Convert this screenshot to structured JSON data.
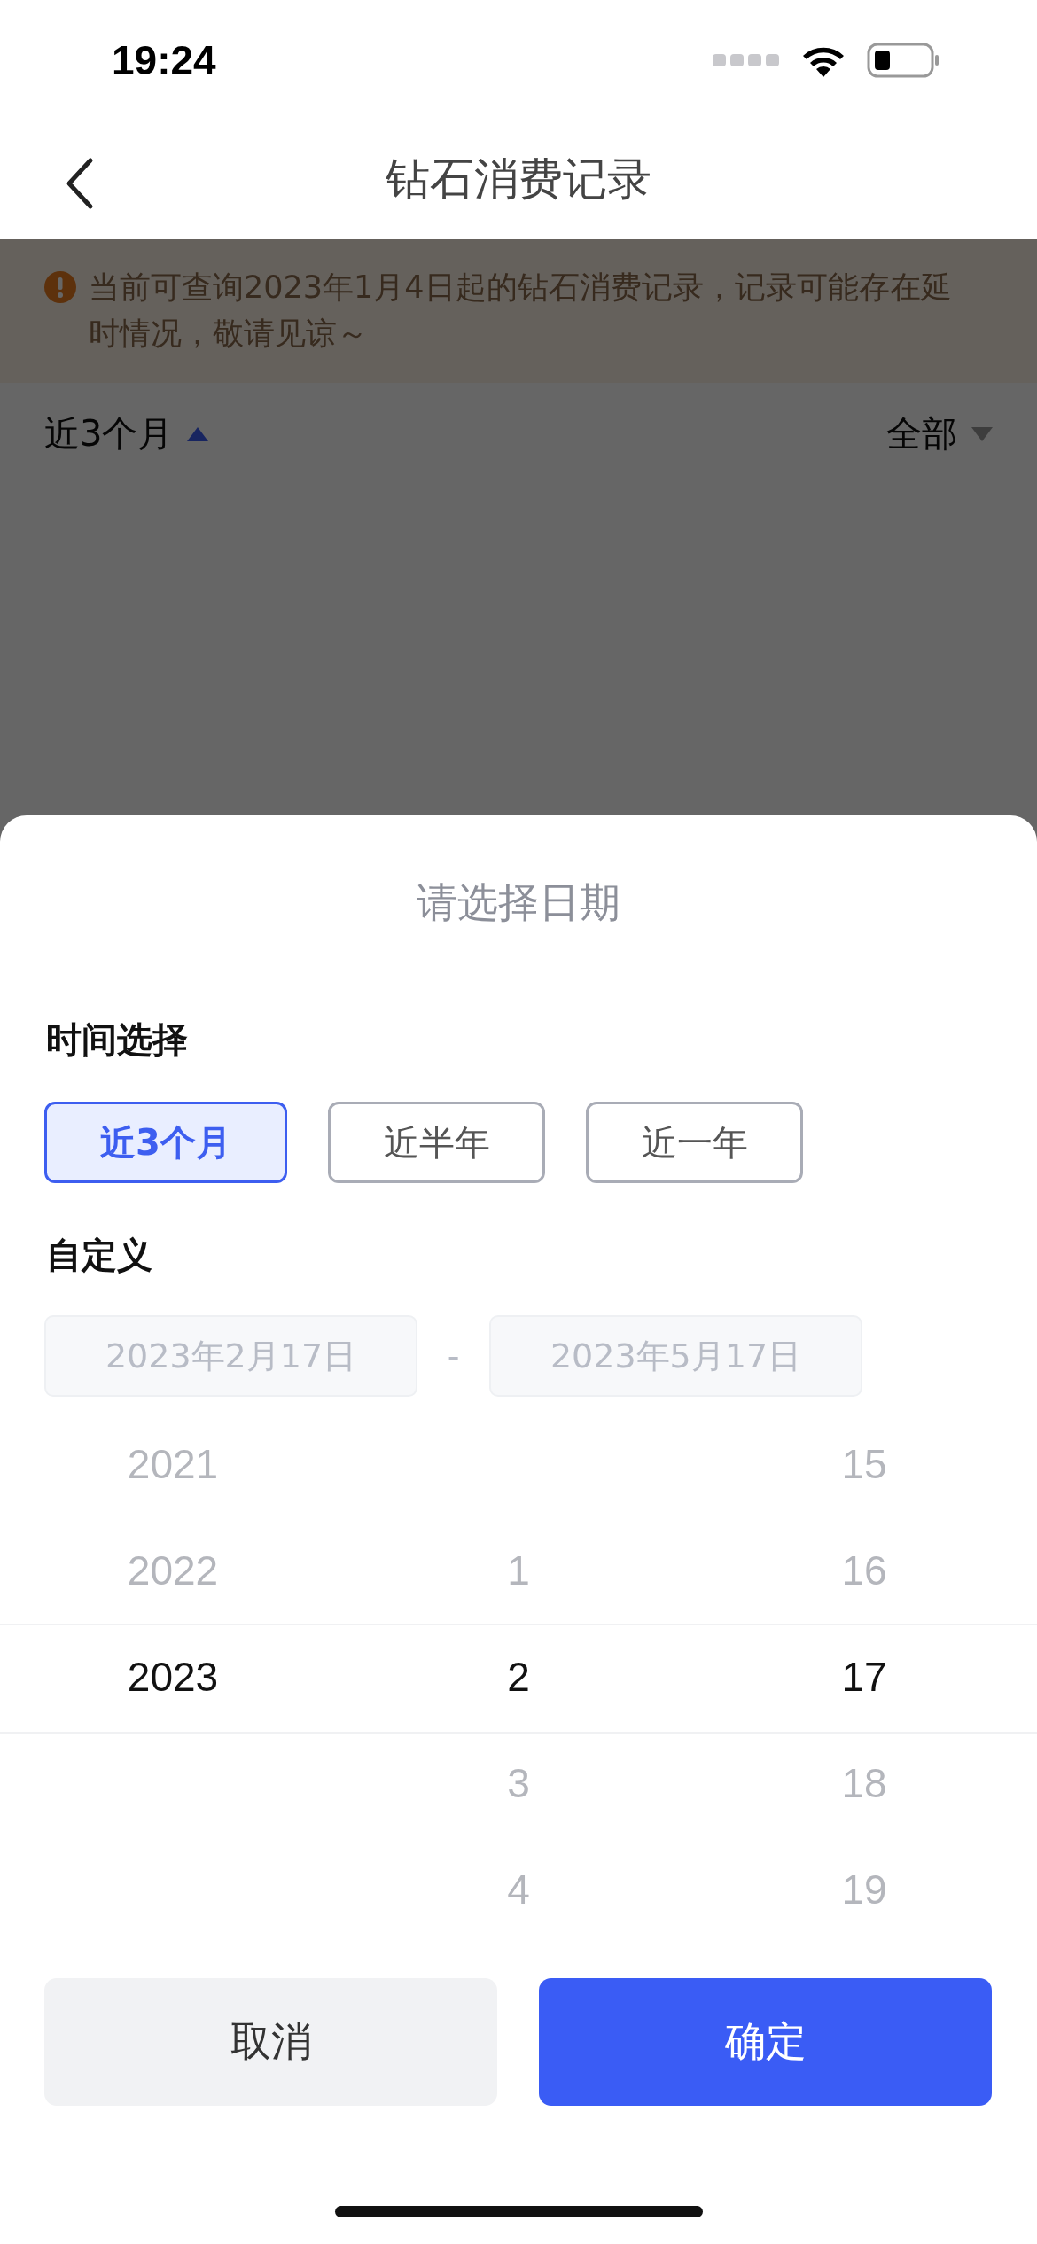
{
  "status_bar": {
    "time": "19:24"
  },
  "nav": {
    "title": "钻石消费记录"
  },
  "notice": {
    "text": "当前可查询2023年1月4日起的钻石消费记录，记录可能存在延时情况，敬请见谅～"
  },
  "filters": [
    {
      "label": "近3个月",
      "expanded": true
    },
    {
      "label": "全部",
      "expanded": false
    }
  ],
  "sheet": {
    "title": "请选择日期",
    "time_section": {
      "label": "时间选择",
      "options": [
        {
          "label": "近3个月",
          "selected": true
        },
        {
          "label": "近半年",
          "selected": false
        },
        {
          "label": "近一年",
          "selected": false
        }
      ]
    },
    "custom_section": {
      "label": "自定义",
      "start": {
        "placeholder": "2023年2月17日"
      },
      "separator": "-",
      "end": {
        "placeholder": "2023年5月17日"
      }
    },
    "picker": {
      "columns": [
        {
          "items": [
            {
              "label": "2021",
              "selected": false
            },
            {
              "label": "2022",
              "selected": false
            },
            {
              "label": "2023",
              "selected": true
            }
          ]
        },
        {
          "items": [
            {
              "label": "1",
              "selected": false
            },
            {
              "label": "2",
              "selected": true
            },
            {
              "label": "3",
              "selected": false
            },
            {
              "label": "4",
              "selected": false
            }
          ]
        },
        {
          "items": [
            {
              "label": "15",
              "selected": false
            },
            {
              "label": "16",
              "selected": false
            },
            {
              "label": "17",
              "selected": true
            },
            {
              "label": "18",
              "selected": false
            },
            {
              "label": "19",
              "selected": false
            }
          ]
        }
      ]
    },
    "buttons": [
      {
        "label": "取消",
        "kind": "secondary"
      },
      {
        "label": "确定",
        "kind": "primary"
      }
    ]
  }
}
